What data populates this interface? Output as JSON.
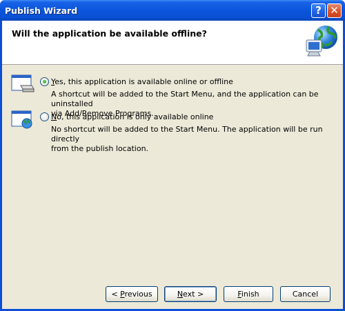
{
  "window": {
    "title": "Publish Wizard",
    "help_glyph": "?",
    "close_glyph": "✕"
  },
  "header": {
    "question": "Will the application be available offline?",
    "icon": "globe-computer-icon"
  },
  "options": [
    {
      "mnemonic": "Y",
      "label_rest": "es, this application is available online or offline",
      "description_line1": "A shortcut will be added to the Start Menu, and the application can be uninstalled",
      "description_line2": "via Add/Remove Programs.",
      "selected": true,
      "icon": "installed-app-icon"
    },
    {
      "mnemonic": "N",
      "label_rest": "o, this application is only available online",
      "description_line1": "No shortcut will be added to the Start Menu. The application will be run directly",
      "description_line2": "from the publish location.",
      "selected": false,
      "icon": "online-app-icon"
    }
  ],
  "buttons": {
    "previous_pre": "< ",
    "previous_mnemonic": "P",
    "previous_rest": "revious",
    "next_mnemonic": "N",
    "next_rest": "ext >",
    "finish_mnemonic": "F",
    "finish_rest": "inish",
    "cancel": "Cancel"
  },
  "colors": {
    "titlebar": "#0a55dc",
    "client": "#ece9d8",
    "radio_dot": "#21a121"
  }
}
